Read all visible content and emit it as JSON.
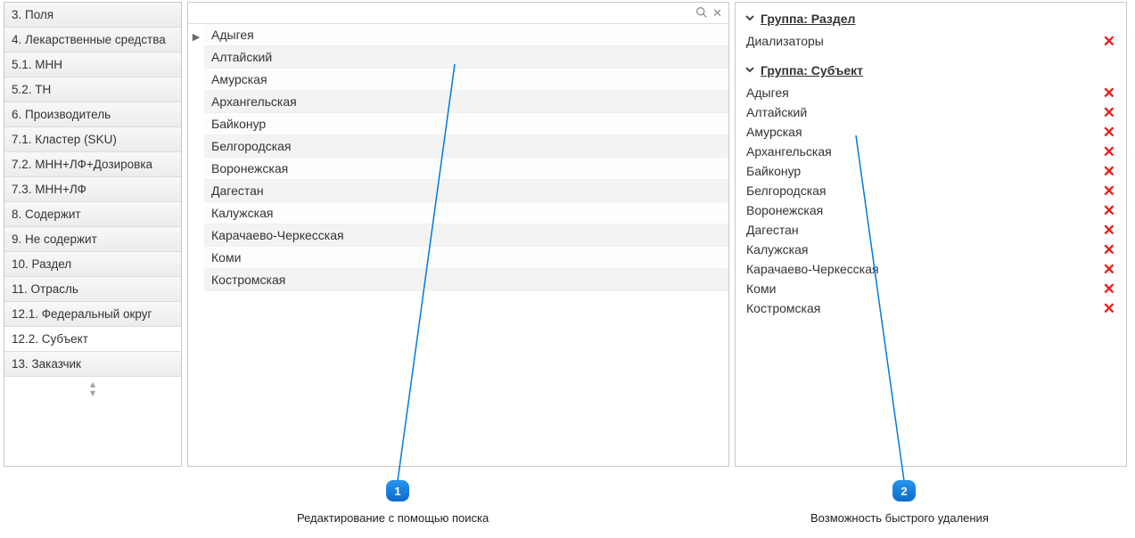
{
  "sidebar": {
    "items": [
      {
        "label": "3. Поля",
        "selected": false
      },
      {
        "label": "4. Лекарственные средства",
        "selected": false
      },
      {
        "label": "5.1. МНН",
        "selected": false
      },
      {
        "label": "5.2. ТН",
        "selected": false
      },
      {
        "label": "6. Производитель",
        "selected": false
      },
      {
        "label": "7.1. Кластер (SKU)",
        "selected": false
      },
      {
        "label": "7.2. МНН+ЛФ+Дозировка",
        "selected": false
      },
      {
        "label": "7.3. МНН+ЛФ",
        "selected": false
      },
      {
        "label": "8. Содержит",
        "selected": false
      },
      {
        "label": "9. Не содержит",
        "selected": false
      },
      {
        "label": "10. Раздел",
        "selected": false
      },
      {
        "label": "11. Отрасль",
        "selected": false
      },
      {
        "label": "12.1. Федеральный округ",
        "selected": false
      },
      {
        "label": "12.2. Субъект",
        "selected": true
      },
      {
        "label": "13. Заказчик",
        "selected": false
      }
    ]
  },
  "center": {
    "search": {
      "value": "",
      "placeholder": ""
    },
    "items": [
      "Адыгея",
      "Алтайский",
      "Амурская",
      "Архангельская",
      "Байконур",
      "Белгородская",
      "Воронежская",
      "Дагестан",
      "Калужская",
      "Карачаево-Черкесская",
      "Коми",
      "Костромская"
    ]
  },
  "right": {
    "groups": [
      {
        "title": "Группа: Раздел",
        "items": [
          "Диализаторы"
        ]
      },
      {
        "title": "Группа: Субъект",
        "items": [
          "Адыгея",
          "Алтайский",
          "Амурская",
          "Архангельская",
          "Байконур",
          "Белгородская",
          "Воронежская",
          "Дагестан",
          "Калужская",
          "Карачаево-Черкесская",
          "Коми",
          "Костромская"
        ]
      }
    ]
  },
  "annotations": {
    "badge1": "1",
    "badge2": "2",
    "caption1": "Редактирование с помощью поиска",
    "caption2": "Возможность быстрого удаления"
  }
}
